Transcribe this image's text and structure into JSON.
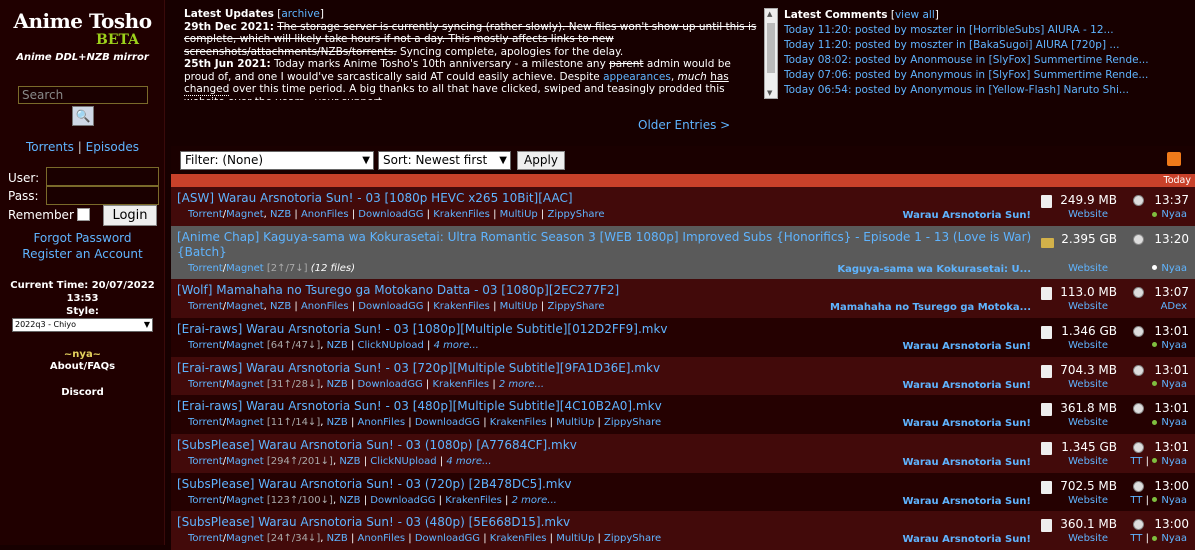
{
  "sidebar": {
    "logo_title": "Anime Tosho",
    "logo_beta": "BETA",
    "logo_subtitle": "Anime DDL+NZB mirror",
    "search_placeholder": "Search",
    "nav_torrents": "Torrents",
    "nav_sep": "|",
    "nav_episodes": "Episodes",
    "user_label": "User:",
    "pass_label": "Pass:",
    "remember_label": "Remember",
    "login_label": "Login",
    "forgot_password": "Forgot Password",
    "register": "Register an Account",
    "current_time": "Current Time: 20/07/2022 13:53",
    "style_label": "Style:",
    "style_value": "2022q3 - Chiyo",
    "nya": "~nya~",
    "about": "About/FAQs",
    "discord": "Discord"
  },
  "updates": {
    "title": "Latest Updates",
    "archive": "archive",
    "e1_date": "29th Dec 2021:",
    "e1_struck": "The storage server is currently syncing (rather slowly). New files won't show up until this is complete, which will likely take hours if not a day. This mostly affects links to new screenshots/attachments/NZBs/torrents.",
    "e1_text": "Syncing complete, apologies for the delay.",
    "e2_date": "25th Jun 2021:",
    "e2_text1": "Today marks Anime Tosho's 10th anniversary - a milestone any",
    "e2_parent": "parent",
    "e2_text2": "admin would be proud of, and one I would've sarcastically said AT could easily achieve. Despite",
    "e2_appearances": "appearances",
    "e2_much": "much",
    "e2_has": "has",
    "e2_changed": "changed",
    "e2_text3": "over this time period. A big thanks to all that have clicked, swiped and teasingly prodded this website over the years - your support"
  },
  "comments": {
    "title": "Latest Comments",
    "view_all": "view all",
    "items": [
      "Today 11:20: posted by moszter in [HorribleSubs] AIURA - 12...",
      "Today 11:20: posted by moszter in [BakaSugoi] AIURA [720p] ...",
      "Today 08:02: posted by Anonmouse in [SlyFox] Summertime Rende...",
      "Today 07:06: posted by Anonymous in [SlyFox] Summertime Rende...",
      "Today 06:54: posted by Anonymous in [Yellow-Flash] Naruto Shi..."
    ]
  },
  "older_entries": "Older Entries >",
  "filters": {
    "filter_value": "Filter: (None)",
    "sort_value": "Sort: Newest first",
    "apply": "Apply"
  },
  "today_label": "Today",
  "rows": [
    {
      "title": "[ASW] Warau Arsnotoria Sun! - 03 [1080p HEVC x265 10Bit][AAC]",
      "links": [
        "Torrent",
        "/",
        "Magnet",
        ", ",
        "NZB",
        " | ",
        "AnonFiles",
        " | ",
        "DownloadGG",
        " | ",
        "KrakenFiles",
        " | ",
        "MultiUp",
        " | ",
        "ZippyShare"
      ],
      "series": "Warau Arsnotoria Sun!",
      "size": "249.9 MB",
      "website": "Website",
      "time": "13:37",
      "sub": "Nyaa",
      "sub_dot": "#7fbf3f",
      "tt": ""
    },
    {
      "title": "[Anime Chap] Kaguya-sama wa Kokurasetai: Ultra Romantic Season 3 [WEB 1080p] Improved Subs {Honorifics} - Episode 1 - 13 (Love is War) {Batch}",
      "links": [
        "Torrent",
        "/",
        "Magnet",
        " [2↑/7↓]",
        " ",
        "(12 files)"
      ],
      "series": "Kaguya-sama wa Kokurasetai: U...",
      "size": "2.395 GB",
      "website": "Website",
      "time": "13:20",
      "sub": "Nyaa",
      "sub_dot": "#ffffff",
      "tt": ""
    },
    {
      "title": "[Wolf] Mamahaha no Tsurego ga Motokano Datta - 03 [1080p][2EC277F2]",
      "links": [
        "Torrent",
        "/",
        "Magnet",
        ", ",
        "NZB",
        " | ",
        "AnonFiles",
        " | ",
        "DownloadGG",
        " | ",
        "KrakenFiles",
        " | ",
        "MultiUp",
        " | ",
        "ZippyShare"
      ],
      "series": "Mamahaha no Tsurego ga Motoka...",
      "size": "113.0 MB",
      "website": "Website",
      "time": "13:07",
      "sub": "ADex",
      "sub_dot": "",
      "tt": ""
    },
    {
      "title": "[Erai-raws] Warau Arsnotoria Sun! - 03 [1080p][Multiple Subtitle][012D2FF9].mkv",
      "links": [
        "Torrent",
        "/",
        "Magnet",
        " [64↑/47↓]",
        ", ",
        "NZB",
        " | ",
        "ClickNUpload",
        " | ",
        "4 more..."
      ],
      "series": "Warau Arsnotoria Sun!",
      "size": "1.346 GB",
      "website": "Website",
      "time": "13:01",
      "sub": "Nyaa",
      "sub_dot": "#7fbf3f",
      "tt": ""
    },
    {
      "title": "[Erai-raws] Warau Arsnotoria Sun! - 03 [720p][Multiple Subtitle][9FA1D36E].mkv",
      "links": [
        "Torrent",
        "/",
        "Magnet",
        " [31↑/28↓]",
        ", ",
        "NZB",
        " | ",
        "DownloadGG",
        " | ",
        "KrakenFiles",
        " | ",
        "2 more..."
      ],
      "series": "Warau Arsnotoria Sun!",
      "size": "704.3 MB",
      "website": "Website",
      "time": "13:01",
      "sub": "Nyaa",
      "sub_dot": "#7fbf3f",
      "tt": ""
    },
    {
      "title": "[Erai-raws] Warau Arsnotoria Sun! - 03 [480p][Multiple Subtitle][4C10B2A0].mkv",
      "links": [
        "Torrent",
        "/",
        "Magnet",
        " [11↑/14↓]",
        ", ",
        "NZB",
        " | ",
        "AnonFiles",
        " | ",
        "DownloadGG",
        " | ",
        "KrakenFiles",
        " | ",
        "MultiUp",
        " | ",
        "ZippyShare"
      ],
      "series": "Warau Arsnotoria Sun!",
      "size": "361.8 MB",
      "website": "Website",
      "time": "13:01",
      "sub": "Nyaa",
      "sub_dot": "#7fbf3f",
      "tt": ""
    },
    {
      "title": "[SubsPlease] Warau Arsnotoria Sun! - 03 (1080p) [A77684CF].mkv",
      "links": [
        "Torrent",
        "/",
        "Magnet",
        " [294↑/201↓]",
        ", ",
        "NZB",
        " | ",
        "ClickNUpload",
        " | ",
        "4 more..."
      ],
      "series": "Warau Arsnotoria Sun!",
      "size": "1.345 GB",
      "website": "Website",
      "time": "13:01",
      "sub": "Nyaa",
      "sub_dot": "#7fbf3f",
      "tt": "TT"
    },
    {
      "title": "[SubsPlease] Warau Arsnotoria Sun! - 03 (720p) [2B478DC5].mkv",
      "links": [
        "Torrent",
        "/",
        "Magnet",
        " [123↑/100↓]",
        ", ",
        "NZB",
        " | ",
        "DownloadGG",
        " | ",
        "KrakenFiles",
        " | ",
        "2 more..."
      ],
      "series": "Warau Arsnotoria Sun!",
      "size": "702.5 MB",
      "website": "Website",
      "time": "13:00",
      "sub": "Nyaa",
      "sub_dot": "#7fbf3f",
      "tt": "TT"
    },
    {
      "title": "[SubsPlease] Warau Arsnotoria Sun! - 03 (480p) [5E668D15].mkv",
      "links": [
        "Torrent",
        "/",
        "Magnet",
        " [24↑/34↓]",
        ", ",
        "NZB",
        " | ",
        "AnonFiles",
        " | ",
        "DownloadGG",
        " | ",
        "KrakenFiles",
        " | ",
        "MultiUp",
        " | ",
        "ZippyShare"
      ],
      "series": "Warau Arsnotoria Sun!",
      "size": "360.1 MB",
      "website": "Website",
      "time": "13:00",
      "sub": "Nyaa",
      "sub_dot": "#7fbf3f",
      "tt": "TT"
    }
  ]
}
